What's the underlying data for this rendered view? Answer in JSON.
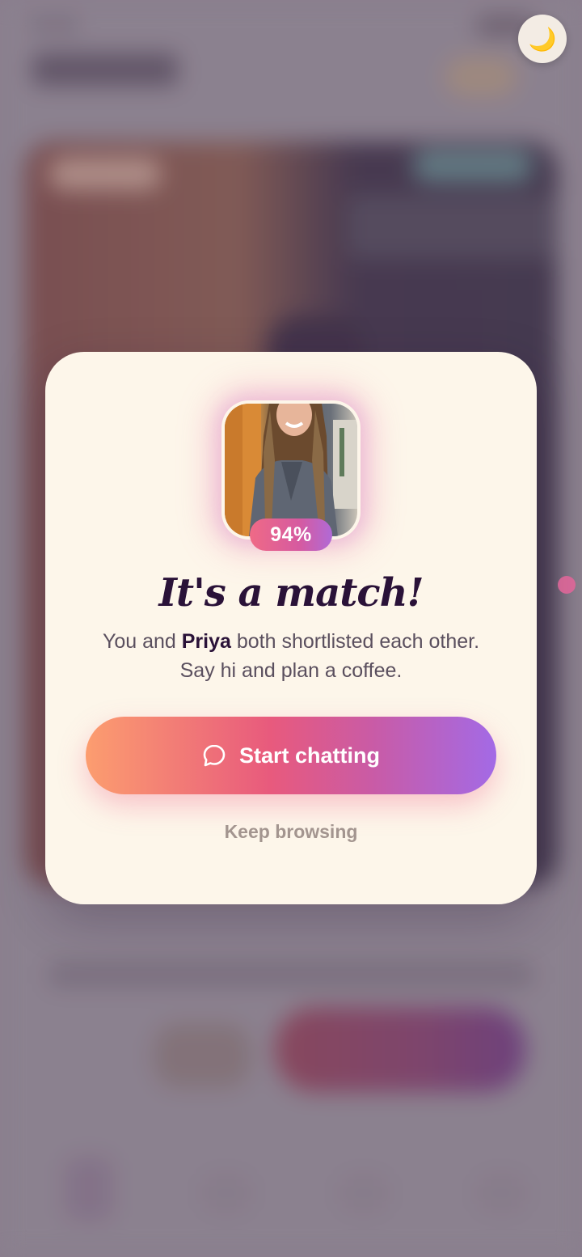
{
  "status_bar": {
    "time": "9:41"
  },
  "theme_toggle": {
    "icon": "moon-icon",
    "glyph": "🌙"
  },
  "match_modal": {
    "photo_alt": "Priya",
    "match_percent": "94%",
    "headline": "It's a match!",
    "subtitle_prefix": "You and ",
    "match_name": "Priya",
    "subtitle_suffix": " both shortlisted each other.",
    "subtitle_line2": "Say hi and plan a coffee.",
    "primary_button": {
      "label": "Start chatting",
      "icon": "chat-bubble-icon"
    },
    "secondary_button": {
      "label": "Keep browsing"
    }
  },
  "colors": {
    "modal_bg": "#fdf6ea",
    "headline": "#2a1238",
    "gradient_start": "#fc9d6f",
    "gradient_mid": "#e85a7d",
    "gradient_end": "#a36ae6",
    "secondary_text": "#a3958f"
  }
}
